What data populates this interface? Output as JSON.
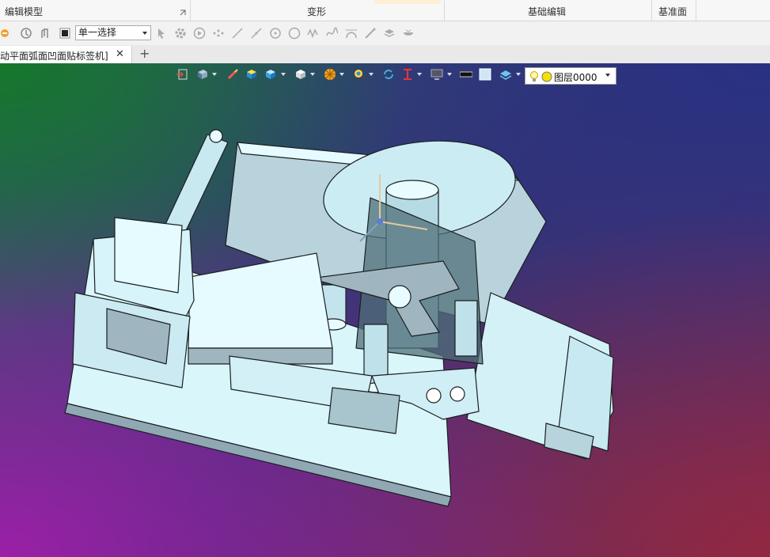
{
  "ribbon": {
    "groups": [
      "编辑模型",
      "变形",
      "基础编辑",
      "基准面"
    ]
  },
  "toolbar": {
    "select_mode": "单一选择"
  },
  "tabs": [
    {
      "label": "动平面弧面凹面贴标签机]",
      "close": "✕"
    }
  ],
  "tab_add": "+",
  "viewport": {
    "layer_name": "图层0000"
  },
  "colors": {
    "model_fill": "#d9f6fb",
    "model_shade": "#9fb6c0",
    "background_top_left": "#1a7a2c",
    "background_bottom_left": "#9a22a8"
  },
  "icons": [
    "undo-history-icon",
    "orbit-icon",
    "pan-icon",
    "stop-icon",
    "pointer-icon",
    "gear-pick-icon",
    "play-icon",
    "point-icon",
    "line-icon",
    "segment-icon",
    "circle-center-icon",
    "circle-icon",
    "spline-icon",
    "curve-icon",
    "arc-icon",
    "pen-icon",
    "stack-icon",
    "bowl-icon"
  ]
}
